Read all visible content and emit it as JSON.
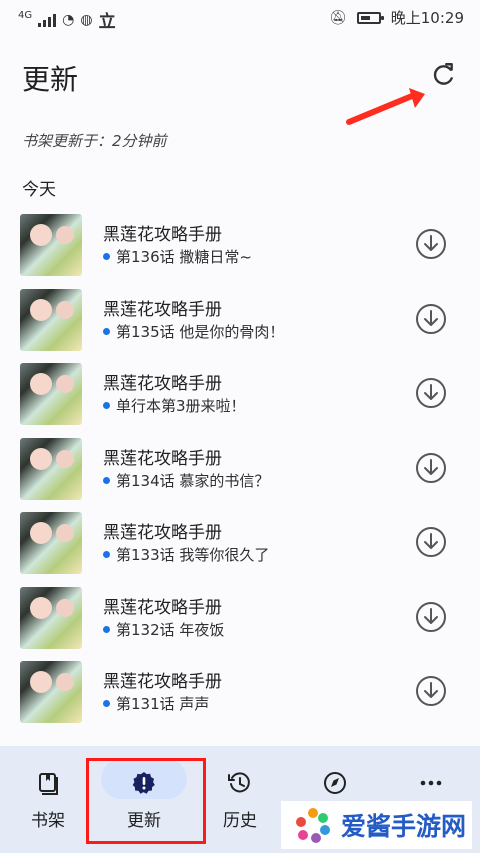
{
  "statusbar": {
    "network": "4G",
    "carrier_badge": "立",
    "time": "晚上10:29"
  },
  "header": {
    "title": "更新",
    "refresh_icon": "refresh-icon"
  },
  "summary": {
    "updated_text": "书架更新于：2分钟前"
  },
  "section": {
    "title": "今天"
  },
  "items": [
    {
      "title": "黑莲花攻略手册",
      "chapter": "第136话 撒糖日常~"
    },
    {
      "title": "黑莲花攻略手册",
      "chapter": "第135话 他是你的骨肉！"
    },
    {
      "title": "黑莲花攻略手册",
      "chapter": "单行本第3册来啦！"
    },
    {
      "title": "黑莲花攻略手册",
      "chapter": "第134话 慕家的书信？"
    },
    {
      "title": "黑莲花攻略手册",
      "chapter": "第133话 我等你很久了"
    },
    {
      "title": "黑莲花攻略手册",
      "chapter": "第132话 年夜饭"
    },
    {
      "title": "黑莲花攻略手册",
      "chapter": "第131话 声声"
    }
  ],
  "nav": {
    "bookshelf": "书架",
    "updates": "更新",
    "history": "历史",
    "discover": "",
    "more": ""
  },
  "watermark": {
    "text": "爱酱手游网"
  },
  "colors": {
    "accent": "#1a73e8",
    "highlight": "#ff1a1a",
    "nav_bg": "#e4ebf7"
  }
}
